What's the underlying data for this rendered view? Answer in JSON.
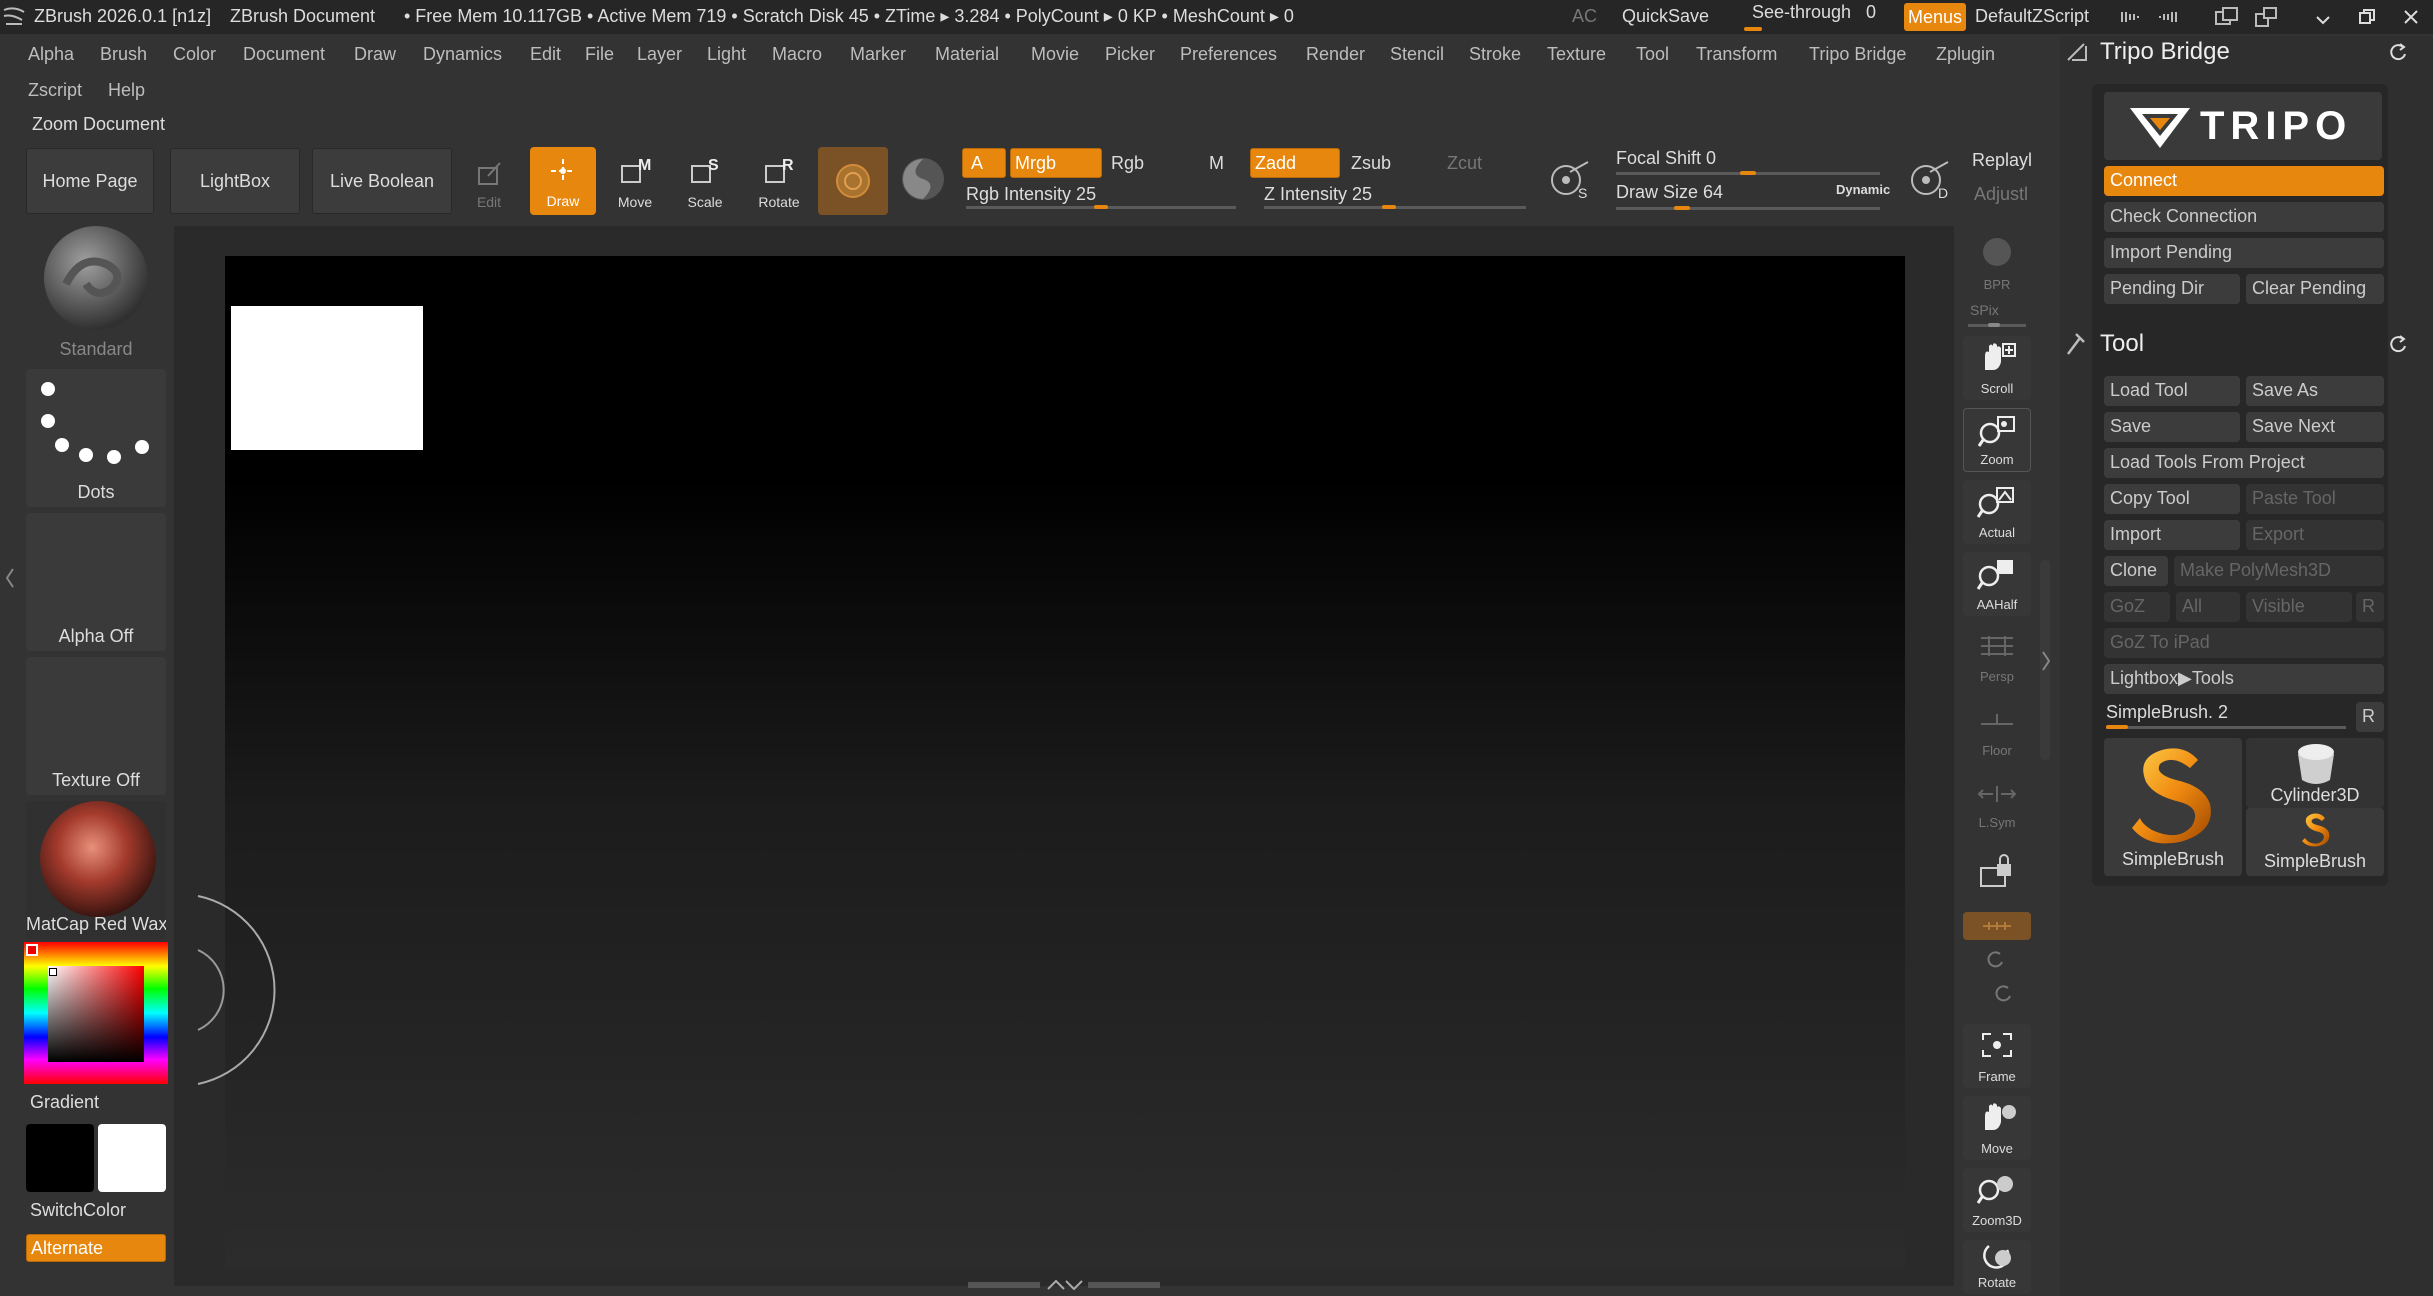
{
  "titlebar": {
    "app_title": "ZBrush 2026.0.1 [n1z]",
    "doc_title": "ZBrush Document",
    "stats": "• Free Mem 10.117GB • Active Mem 719 • Scratch Disk 45 • ZTime ▸ 3.284 • PolyCount ▸ 0 KP • MeshCount ▸ 0",
    "ac": "AC",
    "quicksave": "QuickSave",
    "see_through": "See-through",
    "see_through_value": "0",
    "menus": "Menus",
    "zscript": "DefaultZScript"
  },
  "menubar": {
    "row1": [
      "Alpha",
      "Brush",
      "Color",
      "Document",
      "Draw",
      "Dynamics",
      "Edit",
      "File",
      "Layer",
      "Light",
      "Macro",
      "Marker",
      "Material",
      "Movie",
      "Picker",
      "Preferences",
      "Render",
      "Stencil",
      "Stroke",
      "Texture",
      "Tool",
      "Transform",
      "Tripo Bridge",
      "Zplugin"
    ],
    "row2": [
      "Zscript",
      "Help"
    ]
  },
  "zoom_document_label": "Zoom Document",
  "toolbar": {
    "home_page": "Home Page",
    "lightbox": "LightBox",
    "live_boolean": "Live Boolean",
    "edit": "Edit",
    "draw": "Draw",
    "move": "Move",
    "scale": "Scale",
    "rotate": "Rotate",
    "a": "A",
    "mrgb": "Mrgb",
    "rgb": "Rgb",
    "m": "M",
    "zadd": "Zadd",
    "zsub": "Zsub",
    "zcut": "Zcut",
    "rgb_intensity": "Rgb Intensity 25",
    "rgb_intensity_value": 25,
    "z_intensity": "Z Intensity 25",
    "z_intensity_value": 25,
    "focal_shift": "Focal Shift 0",
    "focal_shift_value": 0,
    "draw_size": "Draw Size 64",
    "draw_size_value": 64,
    "dynamic": "Dynamic",
    "replay": "Replayl",
    "adjust": "Adjustl"
  },
  "left_shelf": {
    "brush": "Standard",
    "stroke": "Dots",
    "alpha": "Alpha Off",
    "texture": "Texture Off",
    "material": "MatCap Red Wax",
    "gradient": "Gradient",
    "switch_color": "SwitchColor",
    "alternate": "Alternate",
    "colors": {
      "main": "#000000",
      "secondary": "#ffffff",
      "material": "#a33a2c",
      "accent": "#e8870e"
    }
  },
  "right_shelf": {
    "bpr": "BPR",
    "spix": "SPix",
    "scroll": "Scroll",
    "zoom": "Zoom",
    "actual": "Actual",
    "aahalf": "AAHalf",
    "persp": "Persp",
    "floor": "Floor",
    "lsym": "L.Sym",
    "frame": "Frame",
    "move": "Move",
    "zoom3d": "Zoom3D",
    "rotate": "Rotate"
  },
  "tripo": {
    "title": "Tripo Bridge",
    "logo": "TRIPO",
    "connect": "Connect",
    "check_connection": "Check Connection",
    "import_pending": "Import Pending",
    "pending_dir": "Pending Dir",
    "clear_pending": "Clear Pending"
  },
  "tool": {
    "title": "Tool",
    "load_tool": "Load Tool",
    "save_as": "Save As",
    "save": "Save",
    "save_next": "Save Next",
    "load_from_project": "Load Tools From Project",
    "copy_tool": "Copy Tool",
    "paste_tool": "Paste Tool",
    "import": "Import",
    "export": "Export",
    "clone": "Clone",
    "make_polymesh": "Make PolyMesh3D",
    "goz": "GoZ",
    "all": "All",
    "visible": "Visible",
    "r": "R",
    "goz_ipad": "GoZ To iPad",
    "lightbox_tools": "Lightbox▶Tools",
    "simplebrush_slider": "SimpleBrush. 2",
    "thumb_big": "SimpleBrush",
    "thumb_cyl": "Cylinder3D",
    "thumb_small": "SimpleBrush"
  }
}
